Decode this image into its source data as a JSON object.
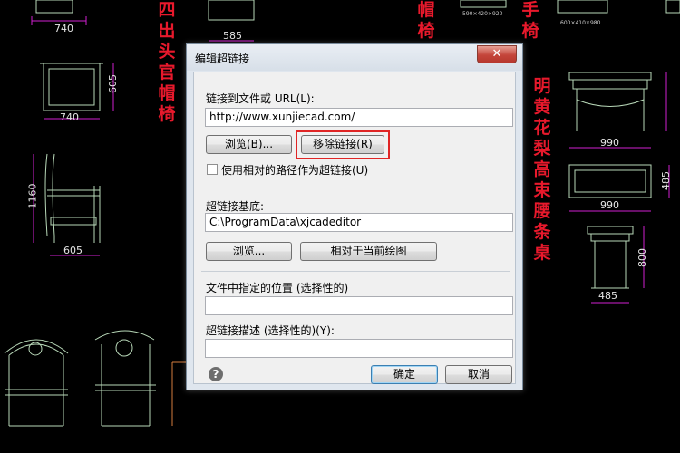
{
  "background": {
    "vertical_titles": [
      "四出头官帽椅",
      "帽椅",
      "手椅",
      "明黄花梨高束腰条桌"
    ],
    "dimensions": [
      "740",
      "585",
      "740",
      "605",
      "1160",
      "605",
      "990",
      "990",
      "485",
      "800",
      "485"
    ],
    "tiny_labels": [
      "590×420×920",
      "600×410×980"
    ],
    "colors": {
      "accent_red": "#e8192c",
      "line_green": "#b8d8b8",
      "line_magenta": "#d020d0"
    }
  },
  "dialog": {
    "title": "编辑超链接",
    "close_symbol": "✕",
    "link_label": "链接到文件或 URL(L):",
    "link_value": "http://www.xunjiecad.com/",
    "browse_button": "浏览(B)...",
    "remove_link_button": "移除链接(R)",
    "relative_path_checkbox": "使用相对的路径作为超链接(U)",
    "base_label": "超链接基底:",
    "base_value": "C:\\ProgramData\\xjcadeditor",
    "browse2_button": "浏览...",
    "relative_drawing_button": "相对于当前绘图",
    "location_label": "文件中指定的位置 (选择性的)",
    "location_value": "",
    "description_label": "超链接描述 (选择性的)(Y):",
    "description_value": "",
    "help_symbol": "?",
    "ok_button": "确定",
    "cancel_button": "取消"
  }
}
